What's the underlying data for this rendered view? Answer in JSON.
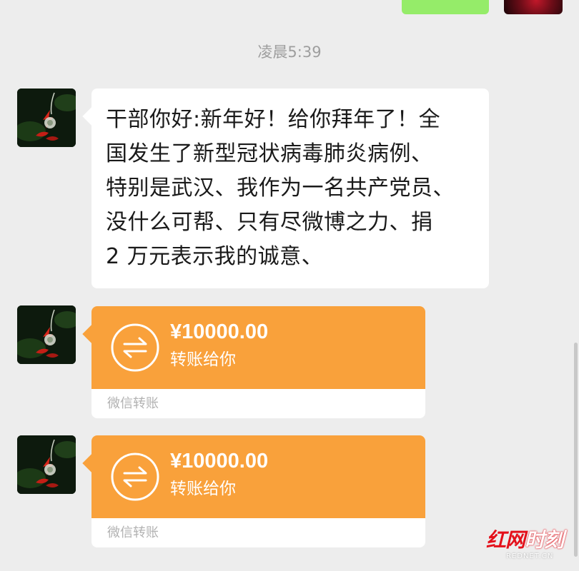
{
  "timestamp": "凌晨5:39",
  "messages": {
    "text": "干部你好:新年好！给你拜年了！全国发生了新型冠状病毒肺炎病例、特别是武汉、我作为一名共产党员、没什么可帮、只有尽微博之力、捐2万元表示我的诚意、",
    "lines": [
      "干部你好:新年好！给你拜年了！全",
      "国发生了新型冠状病毒肺炎病例、",
      "特别是武汉、我作为一名共产党员、",
      "没什么可帮、只有尽微博之力、捐",
      "2 万元表示我的诚意、"
    ]
  },
  "transfers": [
    {
      "amount": "¥10000.00",
      "desc": "转账给你",
      "footer": "微信转账"
    },
    {
      "amount": "¥10000.00",
      "desc": "转账给你",
      "footer": "微信转账"
    }
  ],
  "watermark": {
    "brand_red": "红网",
    "brand_white": "时刻",
    "domain": "REDNET.CN"
  },
  "colors": {
    "background": "#ededed",
    "own_bubble": "#95ec69",
    "transfer_orange": "#f9a13b",
    "timestamp_text": "#9e9e9e",
    "footer_text": "#b2b2b2",
    "watermark_red": "#e4101b"
  },
  "icons": {
    "transfer_icon": "transfer-arrows-icon",
    "avatar": "red-flower-avatar"
  }
}
